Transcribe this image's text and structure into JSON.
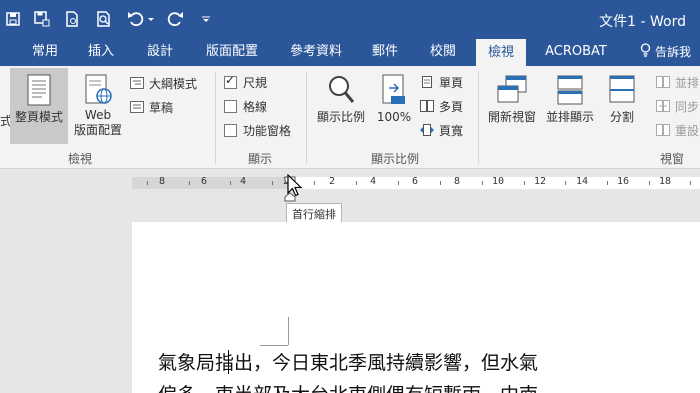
{
  "title_bar": {
    "document_title": "文件1 - Word",
    "quick_access": [
      "save-icon",
      "save-as-icon",
      "print-preview-icon",
      "preview-icon",
      "undo-icon",
      "redo-icon",
      "customize-icon"
    ]
  },
  "tabs": [
    "常用",
    "插入",
    "設計",
    "版面配置",
    "參考資料",
    "郵件",
    "校閱",
    "檢視",
    "ACROBAT"
  ],
  "active_tab": "檢視",
  "tell_me": "告訴我",
  "ribbon": {
    "views": {
      "label": "檢視",
      "cut_text": "式",
      "print_layout": "整頁模式",
      "web_layout_line1": "Web",
      "web_layout_line2": "版面配置",
      "outline": "大綱模式",
      "draft": "草稿"
    },
    "show": {
      "label": "顯示",
      "ruler": "尺規",
      "ruler_checked": true,
      "gridlines": "格線",
      "gridlines_checked": false,
      "nav_pane": "功能窗格",
      "nav_pane_checked": false
    },
    "zoom": {
      "label": "顯示比例",
      "zoom": "顯示比例",
      "percent": "100%",
      "one_page": "單頁",
      "multi_page": "多頁",
      "page_width": "頁寬"
    },
    "window": {
      "label": "視窗",
      "new_window": "開新視窗",
      "arrange": "並排顯示",
      "split": "分割",
      "side_by_side": "並排",
      "sync_scroll": "同步",
      "reset": "重設"
    }
  },
  "ruler": {
    "left_numbers": [
      "8",
      "6",
      "4",
      "2"
    ],
    "right_numbers": [
      "2",
      "4",
      "6",
      "8",
      "10",
      "12",
      "14",
      "16",
      "18"
    ],
    "tooltip": "首行縮排"
  },
  "document": {
    "line1": "氣象局指出，今日東北季風持續影響，但水氣",
    "line2": "偏多，東半部及大台北東側偶有短暫雨，中南"
  },
  "colors": {
    "brand": "#2b579a",
    "ribbon_bg": "#f3f3f3",
    "workspace": "#e6e6e6"
  }
}
